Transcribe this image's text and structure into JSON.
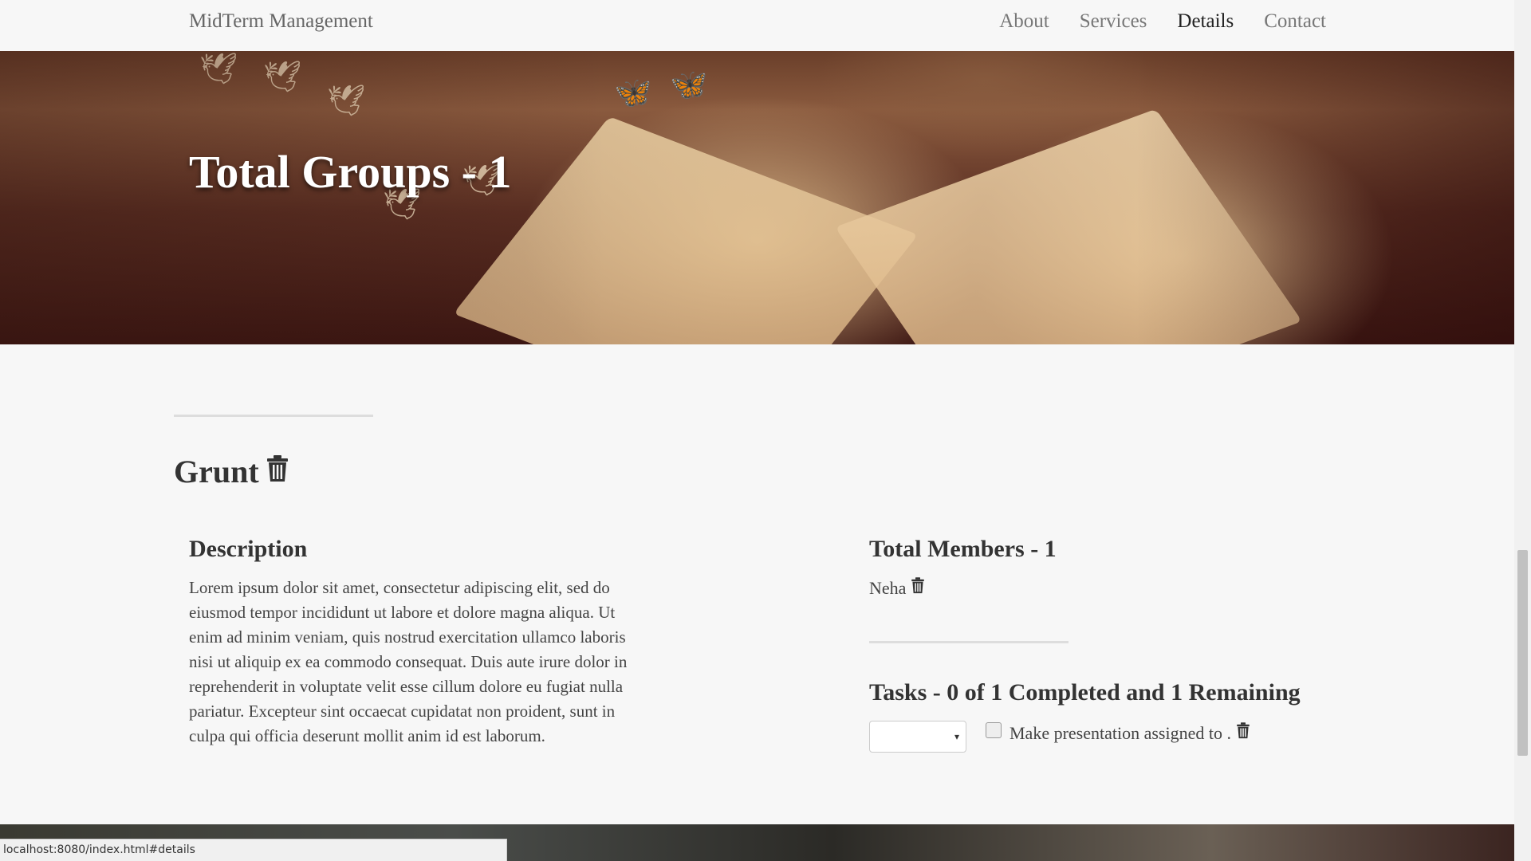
{
  "navbar": {
    "brand": "MidTerm Management",
    "links": [
      {
        "label": "About"
      },
      {
        "label": "Services"
      },
      {
        "label": "Details"
      },
      {
        "label": "Contact"
      }
    ],
    "active": "Details"
  },
  "hero": {
    "title": "Total Groups - 1"
  },
  "group": {
    "name": "Grunt",
    "description_title": "Description",
    "description": "Lorem ipsum dolor sit amet, consectetur adipiscing elit, sed do eiusmod tempor incididunt ut labore et dolore magna aliqua. Ut enim ad minim veniam, quis nostrud exercitation ullamco laboris nisi ut aliquip ex ea commodo consequat. Duis aute irure dolor in reprehenderit in voluptate velit esse cillum dolore eu fugiat nulla pariatur. Excepteur sint occaecat cupidatat non proident, sunt in culpa qui officia deserunt mollit anim id est laborum.",
    "members_title": "Total Members - 1",
    "members": [
      "Neha"
    ],
    "tasks_title": "Tasks - 0 of 1 Completed and 1 Remaining",
    "tasks": [
      {
        "label": "Make presentation assigned to .",
        "completed": false,
        "assignee": ""
      }
    ]
  },
  "status_bar": {
    "url": "localhost:8080/index.html#details"
  },
  "icons": {
    "delete": "trash-icon",
    "select_arrow": "▾"
  }
}
